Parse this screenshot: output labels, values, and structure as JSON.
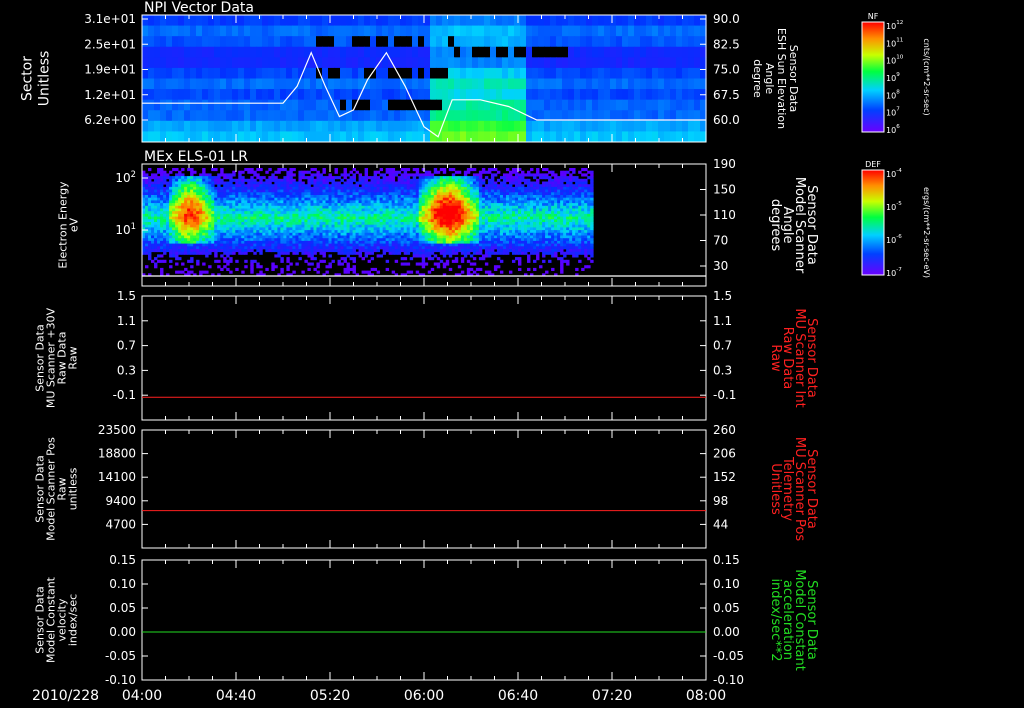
{
  "chart_data": {
    "type": "heatmap",
    "date_label": "2010/228",
    "x_ticks": [
      "04:00",
      "04:40",
      "05:20",
      "06:00",
      "06:40",
      "07:20",
      "08:00"
    ],
    "x_range": [
      "04:00",
      "08:00"
    ],
    "panels": [
      {
        "id": "npi",
        "type": "heatmap",
        "title": "NPI Vector Data",
        "ylabel": [
          "Sector",
          "Unitless"
        ],
        "yticks_left": [
          "3.1e+01",
          "2.5e+01",
          "1.9e+01",
          "1.2e+01",
          "6.2e+00"
        ],
        "right_label": [
          "Sensor Data",
          "ESH Sun Elevation",
          "Angle",
          "degree"
        ],
        "right_label_color": "#ffffff",
        "yticks_right": [
          "90.0",
          "82.5",
          "75.0",
          "67.5",
          "60.0"
        ],
        "overlay_line": {
          "color": "#ffffff",
          "x": [
            "04:00",
            "05:00",
            "05:06",
            "05:12",
            "05:18",
            "05:24",
            "05:30",
            "05:36",
            "05:44",
            "05:52",
            "06:00",
            "06:06",
            "06:12",
            "06:24",
            "06:36",
            "06:48",
            "08:00"
          ],
          "y": [
            65.0,
            65.0,
            70.0,
            80.0,
            70.0,
            61.0,
            63.0,
            72.0,
            80.0,
            70.0,
            58.0,
            55.0,
            66.0,
            66.0,
            64.0,
            60.0,
            60.0
          ]
        },
        "colorbar": {
          "label": "NF",
          "units": "cnts/(cm**2-sr-sec)",
          "ticks": [
            "10^12",
            "10^11",
            "10^10",
            "10^9",
            "10^8",
            "10^7",
            "10^6"
          ]
        }
      },
      {
        "id": "els",
        "type": "heatmap",
        "title": "MEx ELS-01 LR",
        "ylabel": [
          "Electron Energy",
          "eV"
        ],
        "yticks_left": [
          "10^2",
          "10^1"
        ],
        "y_log": true,
        "right_label": [
          "Sensor Data",
          "Model Scanner",
          "Angle",
          "degrees"
        ],
        "right_label_color": "#ffffff",
        "yticks_right": [
          "190",
          "150",
          "110",
          "70",
          "30"
        ],
        "overlay_line": {
          "color": "#ffffff",
          "x": [
            "04:00",
            "08:00"
          ],
          "y": [
            15,
            15
          ]
        },
        "data_end": "07:12",
        "hot_spots": [
          {
            "x": "04:20",
            "label": "high flux"
          },
          {
            "x": "06:10",
            "label": "high flux"
          }
        ],
        "colorbar": {
          "label": "DEF",
          "units": "ergs/(cm**2-sr-sec-eV)",
          "ticks": [
            "10^-4",
            "10^-5",
            "10^-6",
            "10^-7"
          ]
        }
      },
      {
        "id": "mu-int",
        "type": "line",
        "ylabel": [
          "Sensor Data",
          "MU Scanner +30V",
          "Raw Data",
          "Raw"
        ],
        "yticks_left": [
          "1.5",
          "1.1",
          "0.7",
          "0.3",
          "-0.1"
        ],
        "ylim": [
          -0.3,
          1.5
        ],
        "right_label": [
          "Sensor Data",
          "MU Scanner Int",
          "Raw Data",
          "Raw"
        ],
        "right_label_color": "#ff2020",
        "yticks_right": [
          "1.5",
          "1.1",
          "0.7",
          "0.3",
          "-0.1"
        ],
        "series": [
          {
            "color": "#ff2020",
            "x": [
              "04:00",
              "08:00"
            ],
            "y": [
              0.0,
              0.0
            ]
          }
        ]
      },
      {
        "id": "mu-pos",
        "type": "line",
        "ylabel": [
          "Sensor Data",
          "Model Scanner Pos",
          "Raw",
          "unitless"
        ],
        "yticks_left": [
          "23500",
          "18800",
          "14100",
          "9400",
          "4700"
        ],
        "ylim": [
          0,
          23500
        ],
        "right_label": [
          "Sensor Data",
          "MU Scanner Pos",
          "Telemetry",
          "Unitless"
        ],
        "right_label_color": "#ff2020",
        "yticks_right": [
          "260",
          "206",
          "152",
          "98",
          "44"
        ],
        "series": [
          {
            "color": "#ff2020",
            "x": [
              "04:00",
              "08:00"
            ],
            "y": [
              80,
              80
            ]
          }
        ]
      },
      {
        "id": "model-const",
        "type": "line",
        "ylabel": [
          "Sensor Data",
          "Model Constant",
          "velocity",
          "index/sec"
        ],
        "yticks_left": [
          "0.15",
          "0.10",
          "0.05",
          "0.00",
          "-0.05",
          "-0.10"
        ],
        "ylim": [
          -0.1,
          0.15
        ],
        "right_label": [
          "Sensor Data",
          "Model Constant",
          "acceleration",
          "index/sec**2"
        ],
        "right_label_color": "#22dd22",
        "yticks_right": [
          "0.15",
          "0.10",
          "0.05",
          "0.00",
          "-0.05",
          "-0.10"
        ],
        "series": [
          {
            "color": "#22dd22",
            "x": [
              "04:00",
              "08:00"
            ],
            "y": [
              0.0,
              0.0
            ]
          }
        ]
      }
    ]
  }
}
